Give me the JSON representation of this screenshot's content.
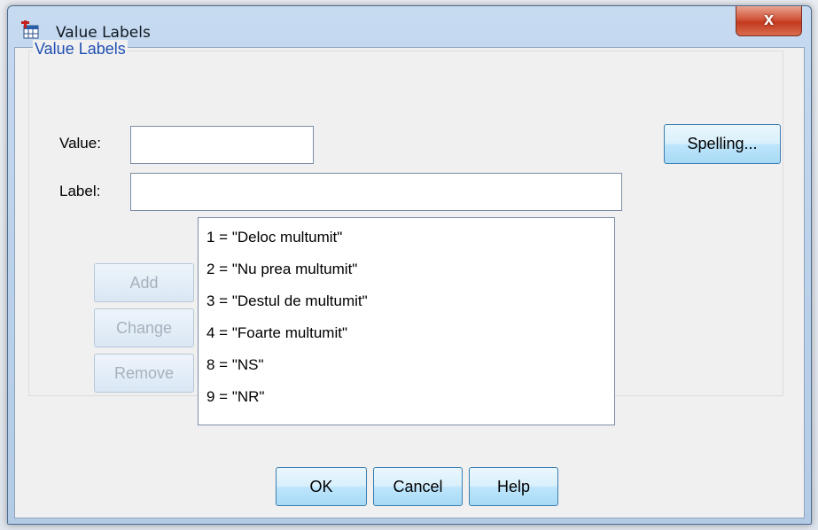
{
  "dialog": {
    "title": "Value Labels",
    "close_label": "x"
  },
  "group": {
    "legend": "Value Labels"
  },
  "fields": {
    "value_label": "Value:",
    "value_input": "",
    "label_label": "Label:",
    "label_input": ""
  },
  "buttons": {
    "spelling": "Spelling...",
    "add": "Add",
    "change": "Change",
    "remove": "Remove",
    "ok": "OK",
    "cancel": "Cancel",
    "help": "Help"
  },
  "value_labels": [
    "1 = \"Deloc multumit\"",
    "2 = \"Nu prea multumit\"",
    "3 = \"Destul de multumit\"",
    "4 = \"Foarte multumit\"",
    "8 = \"NS\"",
    "9 = \"NR\""
  ],
  "colors": {
    "legend_text": "#1f4fb3",
    "close_button": "#c33a1f"
  },
  "icons": {
    "title": "value-labels-app-icon",
    "close": "close-icon"
  }
}
